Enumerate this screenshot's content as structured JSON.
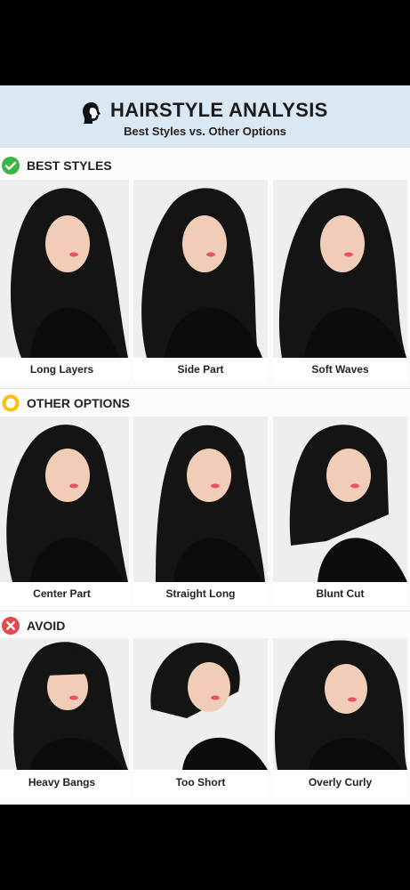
{
  "header": {
    "title": "HAIRSTYLE ANALYSIS",
    "subtitle": "Best Styles vs. Other Options",
    "icon": "head-silhouette-icon"
  },
  "sections": [
    {
      "label": "BEST STYLES",
      "icon": "green-check-icon",
      "accent": "#3bb54a",
      "items": [
        {
          "caption": "Long Layers"
        },
        {
          "caption": "Side Part"
        },
        {
          "caption": "Soft Waves"
        }
      ]
    },
    {
      "label": "OTHER OPTIONS",
      "icon": "yellow-circle-icon",
      "accent": "#f4c20d",
      "items": [
        {
          "caption": "Center Part"
        },
        {
          "caption": "Straight Long"
        },
        {
          "caption": "Blunt Cut"
        }
      ]
    },
    {
      "label": "AVOID",
      "icon": "red-x-icon",
      "accent": "#e5484d",
      "items": [
        {
          "caption": "Heavy Bangs"
        },
        {
          "caption": "Too Short"
        },
        {
          "caption": "Overly Curly"
        }
      ]
    }
  ]
}
